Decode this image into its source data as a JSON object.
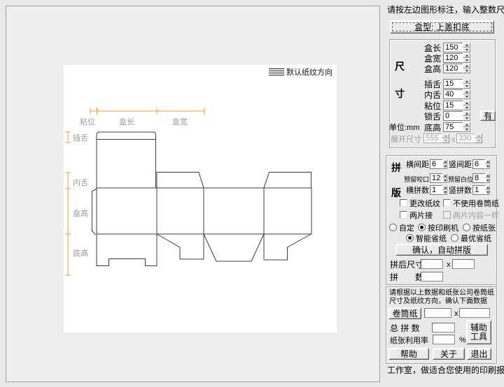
{
  "instruction": "请按左边图形标注，输入整数尺寸。",
  "box_type_button": "盒型: 上盖扣底",
  "canvas": {
    "grain_label": "默认纸纹方向",
    "top_dims": {
      "d0": "粘位",
      "d1": "盒长",
      "d2": "盒宽"
    },
    "left_dims": {
      "d0": "插舌",
      "d1": "内舌",
      "d2": "盒高",
      "d3": "底高"
    }
  },
  "size_group": {
    "title_char1": "尺",
    "title_char2": "寸",
    "unit_label": "单位:mm",
    "rows": [
      {
        "label": "盒长",
        "value": "150"
      },
      {
        "label": "盒宽",
        "value": "120"
      },
      {
        "label": "盒高",
        "value": "120"
      },
      {
        "label": "插舌",
        "value": "15"
      },
      {
        "label": "内舌",
        "value": "40"
      },
      {
        "label": "粘位",
        "value": "15"
      },
      {
        "label": "锁舌",
        "value": "0"
      },
      {
        "label": "底高",
        "value": "75"
      }
    ],
    "lock_button": "有",
    "unfold_label": "展开尺寸",
    "unfold_width": "555",
    "unfold_sep": "x",
    "unfold_height": "330"
  },
  "impose_group": {
    "title_char1": "拼",
    "title_char2": "版",
    "pairs": [
      {
        "l1": "横间距",
        "v1": "6",
        "l2": "竖间距",
        "v2": "6"
      },
      {
        "l1": "预留咬口",
        "v1": "12",
        "l2": "预留白位",
        "v2": "8"
      },
      {
        "l1": "横拼数",
        "v1": "1",
        "l2": "竖拼数",
        "v2": "1"
      }
    ],
    "checkboxes": [
      {
        "label": "更改纸纹"
      },
      {
        "label": "不使用卷筒纸"
      },
      {
        "label": "两片接"
      },
      {
        "label": "两片内容一样"
      }
    ],
    "radio_row1": [
      {
        "label": "自定"
      },
      {
        "label": "按印刷机"
      },
      {
        "label": "按纸张"
      }
    ],
    "radio_row2": [
      {
        "label": "智能省纸"
      },
      {
        "label": "最优省纸"
      }
    ],
    "confirm_button": "确认，自动拼版",
    "after_size_label": "拼后尺寸",
    "after_size_sep": "x",
    "count_label": "拼　　数"
  },
  "paper_group": {
    "note_line1": "请根据以上数据和纸张公司卷筒纸",
    "note_line2": "尺寸及纸纹方向，确认下面数据",
    "roll_button": "卷筒纸",
    "roll_sep": "x",
    "total_label": "总 拼 数",
    "util_label": "纸张利用率",
    "percent_label": "%",
    "tool_button_line1": "辅助",
    "tool_button_line2": "工具",
    "help_button": "帮助",
    "about_button": "关于",
    "exit_button": "退出"
  },
  "status_text": "工作室，做适合您使用的印刷报价软件"
}
